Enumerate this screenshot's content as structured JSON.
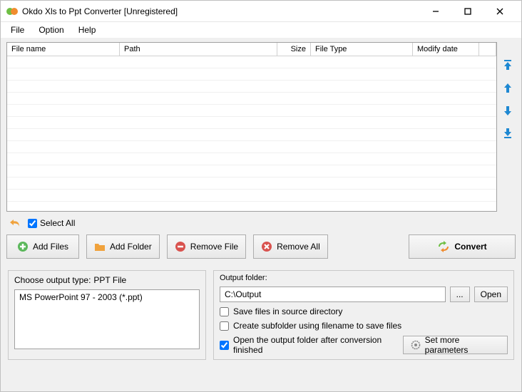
{
  "window": {
    "title": "Okdo Xls to Ppt Converter [Unregistered]"
  },
  "menu": {
    "file": "File",
    "option": "Option",
    "help": "Help"
  },
  "grid": {
    "cols": {
      "name": "File name",
      "path": "Path",
      "size": "Size",
      "type": "File Type",
      "date": "Modify date"
    }
  },
  "selall": {
    "label": "Select All",
    "checked": true
  },
  "buttons": {
    "add_files": "Add Files",
    "add_folder": "Add Folder",
    "remove_file": "Remove File",
    "remove_all": "Remove All",
    "convert": "Convert"
  },
  "output_type": {
    "legend_prefix": "Choose output type:",
    "legend_value": "PPT File",
    "item": "MS PowerPoint 97 - 2003 (*.ppt)"
  },
  "output_folder": {
    "label": "Output folder:",
    "value": "C:\\Output",
    "browse": "...",
    "open": "Open"
  },
  "options": {
    "save_in_source": {
      "label": "Save files in source directory",
      "checked": false
    },
    "create_subfolder": {
      "label": "Create subfolder using filename to save files",
      "checked": false
    },
    "open_after": {
      "label": "Open the output folder after conversion finished",
      "checked": true
    }
  },
  "more_params": "Set more parameters"
}
